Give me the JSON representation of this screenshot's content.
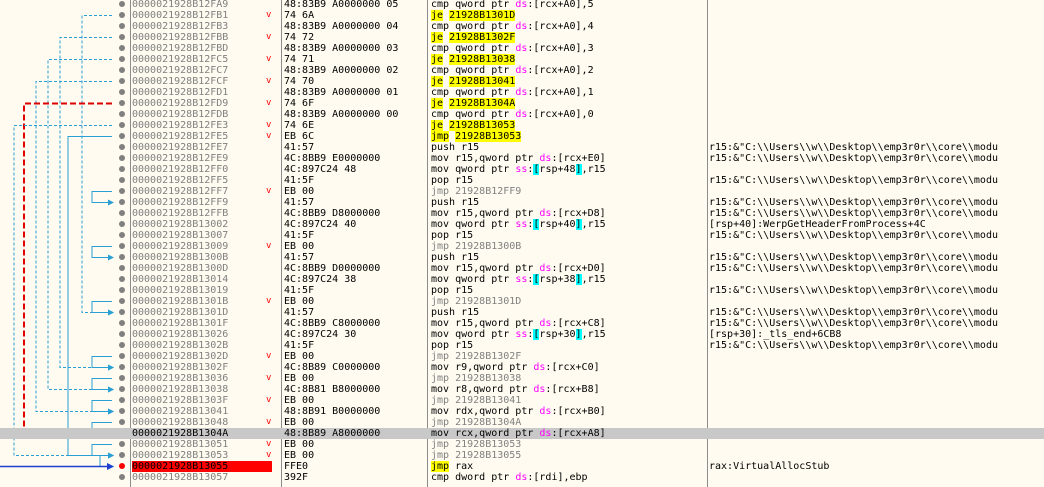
{
  "rows": [
    {
      "addr": "0000021928B12FA9",
      "mark": "",
      "bytes": "48:83B9 A0000000 05",
      "m": "cmp",
      "mcls": "mn",
      "ops": [
        {
          "t": "qword ptr "
        },
        {
          "t": "ds",
          "c": "seg"
        },
        {
          "t": ":["
        },
        {
          "t": "rcx+A0"
        },
        {
          "t": "],5"
        }
      ],
      "cmt": ""
    },
    {
      "addr": "0000021928B12FB1",
      "mark": "v",
      "bytes": "74 6A",
      "m": "je",
      "mcls": "mn-jcc",
      "ops": [
        {
          "t": "21928B1301D",
          "c": "tgt"
        }
      ],
      "cmt": ""
    },
    {
      "addr": "0000021928B12FB3",
      "mark": "",
      "bytes": "48:83B9 A0000000 04",
      "m": "cmp",
      "mcls": "mn",
      "ops": [
        {
          "t": "qword ptr "
        },
        {
          "t": "ds",
          "c": "seg"
        },
        {
          "t": ":["
        },
        {
          "t": "rcx+A0"
        },
        {
          "t": "],4"
        }
      ],
      "cmt": ""
    },
    {
      "addr": "0000021928B12FBB",
      "mark": "v",
      "bytes": "74 72",
      "m": "je",
      "mcls": "mn-jcc",
      "ops": [
        {
          "t": "21928B1302F",
          "c": "tgt"
        }
      ],
      "cmt": ""
    },
    {
      "addr": "0000021928B12FBD",
      "mark": "",
      "bytes": "48:83B9 A0000000 03",
      "m": "cmp",
      "mcls": "mn",
      "ops": [
        {
          "t": "qword ptr "
        },
        {
          "t": "ds",
          "c": "seg"
        },
        {
          "t": ":["
        },
        {
          "t": "rcx+A0"
        },
        {
          "t": "],3"
        }
      ],
      "cmt": ""
    },
    {
      "addr": "0000021928B12FC5",
      "mark": "v",
      "bytes": "74 71",
      "m": "je",
      "mcls": "mn-jcc",
      "ops": [
        {
          "t": "21928B13038",
          "c": "tgt"
        }
      ],
      "cmt": ""
    },
    {
      "addr": "0000021928B12FC7",
      "mark": "",
      "bytes": "48:83B9 A0000000 02",
      "m": "cmp",
      "mcls": "mn",
      "ops": [
        {
          "t": "qword ptr "
        },
        {
          "t": "ds",
          "c": "seg"
        },
        {
          "t": ":["
        },
        {
          "t": "rcx+A0"
        },
        {
          "t": "],2"
        }
      ],
      "cmt": ""
    },
    {
      "addr": "0000021928B12FCF",
      "mark": "v",
      "bytes": "74 70",
      "m": "je",
      "mcls": "mn-jcc",
      "ops": [
        {
          "t": "21928B13041",
          "c": "tgt"
        }
      ],
      "cmt": ""
    },
    {
      "addr": "0000021928B12FD1",
      "mark": "",
      "bytes": "48:83B9 A0000000 01",
      "m": "cmp",
      "mcls": "mn",
      "ops": [
        {
          "t": "qword ptr "
        },
        {
          "t": "ds",
          "c": "seg"
        },
        {
          "t": ":["
        },
        {
          "t": "rcx+A0"
        },
        {
          "t": "],1"
        }
      ],
      "cmt": ""
    },
    {
      "addr": "0000021928B12FD9",
      "mark": "v",
      "bytes": "74 6F",
      "m": "je",
      "mcls": "mn-jcc",
      "ops": [
        {
          "t": "21928B1304A",
          "c": "tgt"
        }
      ],
      "cmt": ""
    },
    {
      "addr": "0000021928B12FDB",
      "mark": "",
      "bytes": "48:83B9 A0000000 00",
      "m": "cmp",
      "mcls": "mn",
      "ops": [
        {
          "t": "qword ptr "
        },
        {
          "t": "ds",
          "c": "seg"
        },
        {
          "t": ":["
        },
        {
          "t": "rcx+A0"
        },
        {
          "t": "],0"
        }
      ],
      "cmt": ""
    },
    {
      "addr": "0000021928B12FE3",
      "mark": "v",
      "bytes": "74 6E",
      "m": "je",
      "mcls": "mn-jcc",
      "ops": [
        {
          "t": "21928B13053",
          "c": "tgt"
        }
      ],
      "cmt": ""
    },
    {
      "addr": "0000021928B12FE5",
      "mark": "v",
      "bytes": "EB 6C",
      "m": "jmp",
      "mcls": "mn-jmp",
      "ops": [
        {
          "t": "21928B13053",
          "c": "tgt"
        }
      ],
      "cmt": ""
    },
    {
      "addr": "0000021928B12FE7",
      "mark": "",
      "bytes": "41:57",
      "m": "push",
      "mcls": "mn",
      "ops": [
        {
          "t": "r15"
        }
      ],
      "cmt": "r15:&\"C:\\\\Users\\\\w\\\\Desktop\\\\emp3r0r\\\\core\\\\modu"
    },
    {
      "addr": "0000021928B12FE9",
      "mark": "",
      "bytes": "4C:8BB9 E0000000",
      "m": "mov",
      "mcls": "mn",
      "ops": [
        {
          "t": "r15,qword ptr "
        },
        {
          "t": "ds",
          "c": "seg"
        },
        {
          "t": ":["
        },
        {
          "t": "rcx+E0"
        },
        {
          "t": "]"
        }
      ],
      "cmt": "r15:&\"C:\\\\Users\\\\w\\\\Desktop\\\\emp3r0r\\\\core\\\\modu"
    },
    {
      "addr": "0000021928B12FF0",
      "mark": "",
      "bytes": "4C:897C24 48",
      "m": "mov",
      "mcls": "mn",
      "ops": [
        {
          "t": "qword ptr "
        },
        {
          "t": "ss",
          "c": "seg"
        },
        {
          "t": ":"
        },
        {
          "t": "[",
          "c": "br"
        },
        {
          "t": "rsp+48"
        },
        {
          "t": "]",
          "c": "br"
        },
        {
          "t": ",r15"
        }
      ],
      "cmt": ""
    },
    {
      "addr": "0000021928B12FF5",
      "mark": "",
      "bytes": "41:5F",
      "m": "pop",
      "mcls": "mn",
      "ops": [
        {
          "t": "r15"
        }
      ],
      "cmt": "r15:&\"C:\\\\Users\\\\w\\\\Desktop\\\\emp3r0r\\\\core\\\\modu"
    },
    {
      "addr": "0000021928B12FF7",
      "mark": "v",
      "bytes": "EB 00",
      "m": "jmp",
      "mcls": "mn-gray",
      "ops": [
        {
          "t": "21928B12FF9",
          "c": "tgtg"
        }
      ],
      "cmt": ""
    },
    {
      "addr": "0000021928B12FF9",
      "mark": "",
      "bytes": "41:57",
      "m": "push",
      "mcls": "mn",
      "ops": [
        {
          "t": "r15"
        }
      ],
      "cmt": "r15:&\"C:\\\\Users\\\\w\\\\Desktop\\\\emp3r0r\\\\core\\\\modu"
    },
    {
      "addr": "0000021928B12FFB",
      "mark": "",
      "bytes": "4C:8BB9 D8000000",
      "m": "mov",
      "mcls": "mn",
      "ops": [
        {
          "t": "r15,qword ptr "
        },
        {
          "t": "ds",
          "c": "seg"
        },
        {
          "t": ":["
        },
        {
          "t": "rcx+D8"
        },
        {
          "t": "]"
        }
      ],
      "cmt": "r15:&\"C:\\\\Users\\\\w\\\\Desktop\\\\emp3r0r\\\\core\\\\modu"
    },
    {
      "addr": "0000021928B13002",
      "mark": "",
      "bytes": "4C:897C24 40",
      "m": "mov",
      "mcls": "mn",
      "ops": [
        {
          "t": "qword ptr "
        },
        {
          "t": "ss",
          "c": "seg"
        },
        {
          "t": ":"
        },
        {
          "t": "[",
          "c": "br"
        },
        {
          "t": "rsp+40"
        },
        {
          "t": "]",
          "c": "br"
        },
        {
          "t": ",r15"
        }
      ],
      "cmt": "[rsp+40]:WerpGetHeaderFromProcess+4C"
    },
    {
      "addr": "0000021928B13007",
      "mark": "",
      "bytes": "41:5F",
      "m": "pop",
      "mcls": "mn",
      "ops": [
        {
          "t": "r15"
        }
      ],
      "cmt": "r15:&\"C:\\\\Users\\\\w\\\\Desktop\\\\emp3r0r\\\\core\\\\modu"
    },
    {
      "addr": "0000021928B13009",
      "mark": "v",
      "bytes": "EB 00",
      "m": "jmp",
      "mcls": "mn-gray",
      "ops": [
        {
          "t": "21928B1300B",
          "c": "tgtg"
        }
      ],
      "cmt": ""
    },
    {
      "addr": "0000021928B1300B",
      "mark": "",
      "bytes": "41:57",
      "m": "push",
      "mcls": "mn",
      "ops": [
        {
          "t": "r15"
        }
      ],
      "cmt": "r15:&\"C:\\\\Users\\\\w\\\\Desktop\\\\emp3r0r\\\\core\\\\modu"
    },
    {
      "addr": "0000021928B1300D",
      "mark": "",
      "bytes": "4C:8BB9 D0000000",
      "m": "mov",
      "mcls": "mn",
      "ops": [
        {
          "t": "r15,qword ptr "
        },
        {
          "t": "ds",
          "c": "seg"
        },
        {
          "t": ":["
        },
        {
          "t": "rcx+D0"
        },
        {
          "t": "]"
        }
      ],
      "cmt": "r15:&\"C:\\\\Users\\\\w\\\\Desktop\\\\emp3r0r\\\\core\\\\modu"
    },
    {
      "addr": "0000021928B13014",
      "mark": "",
      "bytes": "4C:897C24 38",
      "m": "mov",
      "mcls": "mn",
      "ops": [
        {
          "t": "qword ptr "
        },
        {
          "t": "ss",
          "c": "seg"
        },
        {
          "t": ":"
        },
        {
          "t": "[",
          "c": "br"
        },
        {
          "t": "rsp+38"
        },
        {
          "t": "]",
          "c": "br"
        },
        {
          "t": ",r15"
        }
      ],
      "cmt": ""
    },
    {
      "addr": "0000021928B13019",
      "mark": "",
      "bytes": "41:5F",
      "m": "pop",
      "mcls": "mn",
      "ops": [
        {
          "t": "r15"
        }
      ],
      "cmt": "r15:&\"C:\\\\Users\\\\w\\\\Desktop\\\\emp3r0r\\\\core\\\\modu"
    },
    {
      "addr": "0000021928B1301B",
      "mark": "v",
      "bytes": "EB 00",
      "m": "jmp",
      "mcls": "mn-gray",
      "ops": [
        {
          "t": "21928B1301D",
          "c": "tgtg"
        }
      ],
      "cmt": ""
    },
    {
      "addr": "0000021928B1301D",
      "mark": "",
      "bytes": "41:57",
      "m": "push",
      "mcls": "mn",
      "ops": [
        {
          "t": "r15"
        }
      ],
      "cmt": "r15:&\"C:\\\\Users\\\\w\\\\Desktop\\\\emp3r0r\\\\core\\\\modu"
    },
    {
      "addr": "0000021928B1301F",
      "mark": "",
      "bytes": "4C:8BB9 C8000000",
      "m": "mov",
      "mcls": "mn",
      "ops": [
        {
          "t": "r15,qword ptr "
        },
        {
          "t": "ds",
          "c": "seg"
        },
        {
          "t": ":["
        },
        {
          "t": "rcx+C8"
        },
        {
          "t": "]"
        }
      ],
      "cmt": "r15:&\"C:\\\\Users\\\\w\\\\Desktop\\\\emp3r0r\\\\core\\\\modu"
    },
    {
      "addr": "0000021928B13026",
      "mark": "",
      "bytes": "4C:897C24 30",
      "m": "mov",
      "mcls": "mn",
      "ops": [
        {
          "t": "qword ptr "
        },
        {
          "t": "ss",
          "c": "seg"
        },
        {
          "t": ":"
        },
        {
          "t": "[",
          "c": "br"
        },
        {
          "t": "rsp+30"
        },
        {
          "t": "]",
          "c": "br"
        },
        {
          "t": ",r15"
        }
      ],
      "cmt": "[rsp+30]:_tls_end+6CB8"
    },
    {
      "addr": "0000021928B1302B",
      "mark": "",
      "bytes": "41:5F",
      "m": "pop",
      "mcls": "mn",
      "ops": [
        {
          "t": "r15"
        }
      ],
      "cmt": "r15:&\"C:\\\\Users\\\\w\\\\Desktop\\\\emp3r0r\\\\core\\\\modu"
    },
    {
      "addr": "0000021928B1302D",
      "mark": "v",
      "bytes": "EB 00",
      "m": "jmp",
      "mcls": "mn-gray",
      "ops": [
        {
          "t": "21928B1302F",
          "c": "tgtg"
        }
      ],
      "cmt": ""
    },
    {
      "addr": "0000021928B1302F",
      "mark": "",
      "bytes": "4C:8B89 C0000000",
      "m": "mov",
      "mcls": "mn",
      "ops": [
        {
          "t": "r9,qword ptr "
        },
        {
          "t": "ds",
          "c": "seg"
        },
        {
          "t": ":["
        },
        {
          "t": "rcx+C0"
        },
        {
          "t": "]"
        }
      ],
      "cmt": ""
    },
    {
      "addr": "0000021928B13036",
      "mark": "v",
      "bytes": "EB 00",
      "m": "jmp",
      "mcls": "mn-gray",
      "ops": [
        {
          "t": "21928B13038",
          "c": "tgtg"
        }
      ],
      "cmt": ""
    },
    {
      "addr": "0000021928B13038",
      "mark": "",
      "bytes": "4C:8B81 B8000000",
      "m": "mov",
      "mcls": "mn",
      "ops": [
        {
          "t": "r8,qword ptr "
        },
        {
          "t": "ds",
          "c": "seg"
        },
        {
          "t": ":["
        },
        {
          "t": "rcx+B8"
        },
        {
          "t": "]"
        }
      ],
      "cmt": ""
    },
    {
      "addr": "0000021928B1303F",
      "mark": "v",
      "bytes": "EB 00",
      "m": "jmp",
      "mcls": "mn-gray",
      "ops": [
        {
          "t": "21928B13041",
          "c": "tgtg"
        }
      ],
      "cmt": ""
    },
    {
      "addr": "0000021928B13041",
      "mark": "",
      "bytes": "48:8B91 B0000000",
      "m": "mov",
      "mcls": "mn",
      "ops": [
        {
          "t": "rdx,qword ptr "
        },
        {
          "t": "ds",
          "c": "seg"
        },
        {
          "t": ":["
        },
        {
          "t": "rcx+B0"
        },
        {
          "t": "]"
        }
      ],
      "cmt": ""
    },
    {
      "addr": "0000021928B13048",
      "mark": "v",
      "bytes": "EB 00",
      "m": "jmp",
      "mcls": "mn-gray",
      "ops": [
        {
          "t": "21928B1304A",
          "c": "tgtg"
        }
      ],
      "cmt": ""
    },
    {
      "addr": "0000021928B1304A",
      "mark": "",
      "bytes": "48:8B89 A8000000",
      "m": "mov",
      "mcls": "mn",
      "ops": [
        {
          "t": "rcx,qword ptr "
        },
        {
          "t": "ds",
          "c": "seg"
        },
        {
          "t": ":["
        },
        {
          "t": "rcx+A8"
        },
        {
          "t": "]"
        }
      ],
      "cmt": "",
      "hl": true,
      "acls": "cur2"
    },
    {
      "addr": "0000021928B13051",
      "mark": "v",
      "bytes": "EB 00",
      "m": "jmp",
      "mcls": "mn-gray",
      "ops": [
        {
          "t": "21928B13053",
          "c": "tgtg"
        }
      ],
      "cmt": ""
    },
    {
      "addr": "0000021928B13053",
      "mark": "v",
      "bytes": "EB 00",
      "m": "jmp",
      "mcls": "mn-gray",
      "ops": [
        {
          "t": "21928B13055",
          "c": "tgtg"
        }
      ],
      "cmt": ""
    },
    {
      "addr": "0000021928B13055",
      "mark": "—",
      "bytes": "FFE0",
      "m": "jmp",
      "mcls": "mn-jmp",
      "ops": [
        {
          "t": "rax"
        }
      ],
      "cmt": "rax:VirtualAllocStub",
      "acls": "cur",
      "dot": "red"
    },
    {
      "addr": "0000021928B13057",
      "mark": "",
      "bytes": "392F",
      "m": "cmp",
      "mcls": "mn",
      "ops": [
        {
          "t": "dword ptr "
        },
        {
          "t": "ds",
          "c": "seg"
        },
        {
          "t": ":[rdi],ebp"
        }
      ],
      "cmt": ""
    }
  ],
  "colors": {
    "background": "#fffbf0",
    "highlight": "#c8c8c8",
    "jcc": "#ffff00",
    "segment": "#ff00ff",
    "bracket": "#00ffff",
    "red": "#ff0000",
    "arrow_blue": "#2a7fd4"
  }
}
